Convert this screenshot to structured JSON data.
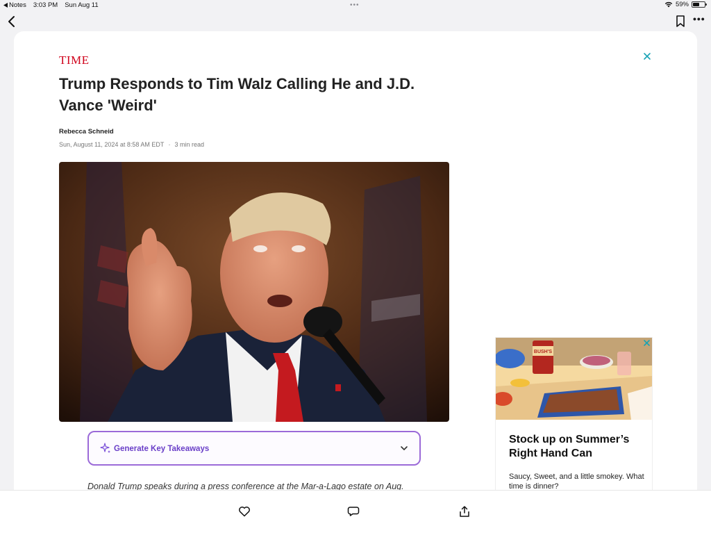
{
  "status_bar": {
    "back_app": "Notes",
    "time": "3:03 PM",
    "date": "Sun Aug 11",
    "battery": "59%",
    "battery_level": 0.59
  },
  "nav": {
    "back_icon": "chevron-left-icon",
    "bookmark_icon": "bookmark-icon",
    "more_icon": "ellipsis-icon",
    "more_label": "•••"
  },
  "article": {
    "brand": "TIME",
    "headline": "Trump Responds to Tim Walz Calling He and J.D. Vance 'Weird'",
    "author": "Rebecca Schneid",
    "date": "Sun, August 11, 2024 at 8:58 AM EDT",
    "separator": "·",
    "read_time": "3 min read",
    "takeaways_label": "Generate Key Takeaways",
    "caption": "Donald Trump speaks during a press conference at the Mar-a-Lago estate on Aug."
  },
  "ad": {
    "title": "Stock up on Summer’s Right Hand Can",
    "body": "Saucy, Sweet, and a little smokey. What time is dinner?",
    "can_label": "BUSH'S"
  },
  "bottom_bar": {
    "icons": [
      "heart-icon",
      "comment-icon",
      "share-icon"
    ]
  },
  "colors": {
    "brand_red": "#d0021b",
    "takeaways_purple": "#6a3fc8",
    "ad_close_teal": "#19a3b5"
  }
}
